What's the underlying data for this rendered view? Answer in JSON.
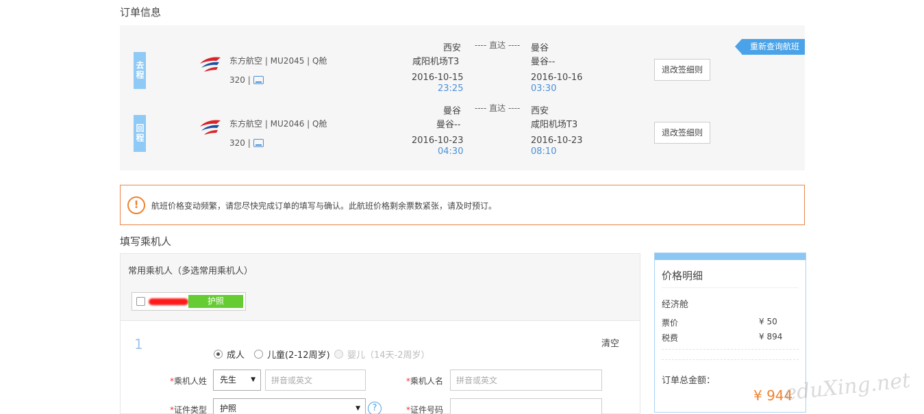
{
  "order_section": {
    "title": "订单信息"
  },
  "requery_label": "重新查询航班",
  "flights": [
    {
      "direction": "去程",
      "airline": "东方航空 | MU2045 | Q舱",
      "plane": "320 |",
      "from_city": "西安",
      "from_airport": "咸阳机场T3",
      "from_date": "2016-10-15",
      "from_time": "23:25",
      "nonstop": "---- 直达 ----",
      "to_city": "曼谷",
      "to_airport": "曼谷--",
      "to_date": "2016-10-16",
      "to_time": "03:30",
      "rule_label": "退改签细则"
    },
    {
      "direction": "回程",
      "airline": "东方航空 | MU2046 | Q舱",
      "plane": "320 |",
      "from_city": "曼谷",
      "from_airport": "曼谷--",
      "from_date": "2016-10-23",
      "from_time": "04:30",
      "nonstop": "---- 直达 ----",
      "to_city": "西安",
      "to_airport": "咸阳机场T3",
      "to_date": "2016-10-23",
      "to_time": "08:10",
      "rule_label": "退改签细则"
    }
  ],
  "warning": {
    "icon": "!",
    "text": "航班价格变动频繁，请您尽快完成订单的填写与确认。此航班价格剩余票数紧张，请及时预订。"
  },
  "passenger_section": {
    "title": "填写乘机人",
    "frequent_title": "常用乘机人（多选常用乘机人）",
    "frequent_chip_doc": "护照",
    "index": "1",
    "clear_label": "清空",
    "types": [
      {
        "label": "成人",
        "state": "selected"
      },
      {
        "label": "儿童(2-12周岁)",
        "state": "enabled"
      },
      {
        "label": "婴儿（14天-2周岁）",
        "state": "disabled"
      }
    ],
    "surname_label": "乘机人姓",
    "title_select": "先生",
    "surname_placeholder": "拼音或英文",
    "given_label": "乘机人名",
    "given_placeholder": "拼音或英文",
    "doc_type_label": "证件类型",
    "doc_type_value": "护照",
    "help_icon": "?",
    "doc_number_label": "证件号码",
    "required_mark": "*",
    "arrow": "▼"
  },
  "price": {
    "title": "价格明细",
    "cabin": "经济舱",
    "fare_label": "票价",
    "fare_value": "¥ 50",
    "tax_label": "税费",
    "tax_value": "¥ 894",
    "total_label": "订单总金额：",
    "total_value": "¥ 944"
  },
  "watermark": "eduXing.net",
  "colors": {
    "accent_blue": "#4aa3e8",
    "warning_orange": "#f0822f",
    "doc_green": "#66cc33"
  }
}
